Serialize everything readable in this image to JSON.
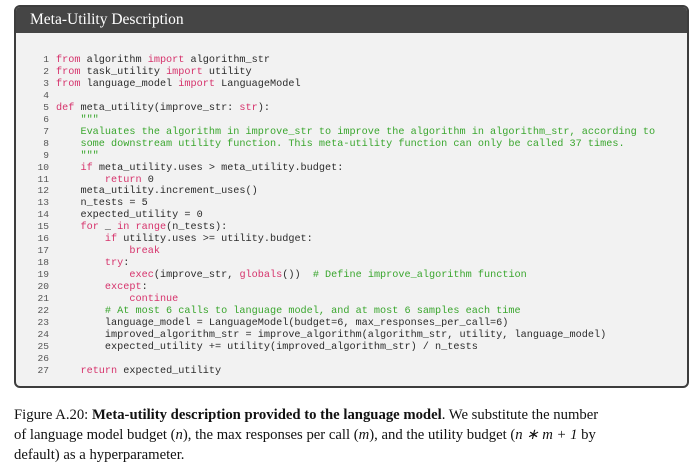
{
  "figure": {
    "title": "Meta-Utility Description",
    "code_lines": [
      {
        "n": "1",
        "seg": [
          {
            "t": "from",
            "c": "kw"
          },
          {
            "t": " algorithm ",
            "c": ""
          },
          {
            "t": "import",
            "c": "kw"
          },
          {
            "t": " algorithm_str",
            "c": ""
          }
        ]
      },
      {
        "n": "2",
        "seg": [
          {
            "t": "from",
            "c": "kw"
          },
          {
            "t": " task_utility ",
            "c": ""
          },
          {
            "t": "import",
            "c": "kw"
          },
          {
            "t": " utility",
            "c": ""
          }
        ]
      },
      {
        "n": "3",
        "seg": [
          {
            "t": "from",
            "c": "kw"
          },
          {
            "t": " language_model ",
            "c": ""
          },
          {
            "t": "import",
            "c": "kw"
          },
          {
            "t": " LanguageModel",
            "c": ""
          }
        ]
      },
      {
        "n": "4",
        "seg": []
      },
      {
        "n": "5",
        "seg": [
          {
            "t": "def",
            "c": "kw"
          },
          {
            "t": " meta_utility(improve_str: ",
            "c": ""
          },
          {
            "t": "str",
            "c": "kw"
          },
          {
            "t": "):",
            "c": ""
          }
        ]
      },
      {
        "n": "6",
        "seg": [
          {
            "t": "    \"\"\"",
            "c": "st"
          }
        ]
      },
      {
        "n": "7",
        "seg": [
          {
            "t": "    Evaluates the algorithm in improve_str to improve the algorithm in algorithm_str, according to",
            "c": "st"
          }
        ]
      },
      {
        "n": "8",
        "seg": [
          {
            "t": "    some downstream utility function. This meta-utility function can only be called 37 times.",
            "c": "st"
          }
        ]
      },
      {
        "n": "9",
        "seg": [
          {
            "t": "    \"\"\"",
            "c": "st"
          }
        ]
      },
      {
        "n": "10",
        "seg": [
          {
            "t": "    ",
            "c": ""
          },
          {
            "t": "if",
            "c": "kw"
          },
          {
            "t": " meta_utility.uses > meta_utility.budget:",
            "c": ""
          }
        ]
      },
      {
        "n": "11",
        "seg": [
          {
            "t": "        ",
            "c": ""
          },
          {
            "t": "return",
            "c": "kw"
          },
          {
            "t": " 0",
            "c": ""
          }
        ]
      },
      {
        "n": "12",
        "seg": [
          {
            "t": "    meta_utility.increment_uses()",
            "c": ""
          }
        ]
      },
      {
        "n": "13",
        "seg": [
          {
            "t": "    n_tests = 5",
            "c": ""
          }
        ]
      },
      {
        "n": "14",
        "seg": [
          {
            "t": "    expected_utility = 0",
            "c": ""
          }
        ]
      },
      {
        "n": "15",
        "seg": [
          {
            "t": "    ",
            "c": ""
          },
          {
            "t": "for",
            "c": "kw"
          },
          {
            "t": " _ ",
            "c": ""
          },
          {
            "t": "in",
            "c": "kw"
          },
          {
            "t": " ",
            "c": ""
          },
          {
            "t": "range",
            "c": "kw"
          },
          {
            "t": "(n_tests):",
            "c": ""
          }
        ]
      },
      {
        "n": "16",
        "seg": [
          {
            "t": "        ",
            "c": ""
          },
          {
            "t": "if",
            "c": "kw"
          },
          {
            "t": " utility.uses >= utility.budget:",
            "c": ""
          }
        ]
      },
      {
        "n": "17",
        "seg": [
          {
            "t": "            ",
            "c": ""
          },
          {
            "t": "break",
            "c": "kw"
          }
        ]
      },
      {
        "n": "18",
        "seg": [
          {
            "t": "        ",
            "c": ""
          },
          {
            "t": "try",
            "c": "kw"
          },
          {
            "t": ":",
            "c": ""
          }
        ]
      },
      {
        "n": "19",
        "seg": [
          {
            "t": "            ",
            "c": ""
          },
          {
            "t": "exec",
            "c": "kw"
          },
          {
            "t": "(improve_str, ",
            "c": ""
          },
          {
            "t": "globals",
            "c": "kw"
          },
          {
            "t": "())  ",
            "c": ""
          },
          {
            "t": "# Define improve_algorithm function",
            "c": "cm"
          }
        ]
      },
      {
        "n": "20",
        "seg": [
          {
            "t": "        ",
            "c": ""
          },
          {
            "t": "except",
            "c": "kw"
          },
          {
            "t": ":",
            "c": ""
          }
        ]
      },
      {
        "n": "21",
        "seg": [
          {
            "t": "            ",
            "c": ""
          },
          {
            "t": "continue",
            "c": "kw"
          }
        ]
      },
      {
        "n": "22",
        "seg": [
          {
            "t": "        ",
            "c": ""
          },
          {
            "t": "# At most 6 calls to language model, and at most 6 samples each time",
            "c": "cm"
          }
        ]
      },
      {
        "n": "23",
        "seg": [
          {
            "t": "        language_model = LanguageModel(budget=6, max_responses_per_call=6)",
            "c": ""
          }
        ]
      },
      {
        "n": "24",
        "seg": [
          {
            "t": "        improved_algorithm_str = improve_algorithm(algorithm_str, utility, language_model)",
            "c": ""
          }
        ]
      },
      {
        "n": "25",
        "seg": [
          {
            "t": "        expected_utility += utility(improved_algorithm_str) / n_tests",
            "c": ""
          }
        ]
      },
      {
        "n": "26",
        "seg": []
      },
      {
        "n": "27",
        "seg": [
          {
            "t": "    ",
            "c": ""
          },
          {
            "t": "return",
            "c": "kw"
          },
          {
            "t": " expected_utility",
            "c": ""
          }
        ]
      }
    ]
  },
  "caption": {
    "label": "Figure A.20: ",
    "bold": "Meta-utility description provided to the language model",
    "line1_rest": ". We substitute the number",
    "line2_a": "of language model budget (",
    "var_n": "n",
    "line2_b": "), the max responses per call (",
    "var_m": "m",
    "line2_c": "), and the utility budget (",
    "expr": "n ∗ m + 1",
    "line2_d": " by",
    "line3": "default) as a hyperparameter."
  },
  "colors": {
    "keyword": "#d6336c",
    "comment": "#3aa62e",
    "header_bg": "#454545",
    "box_bg": "#f2f2f2"
  }
}
